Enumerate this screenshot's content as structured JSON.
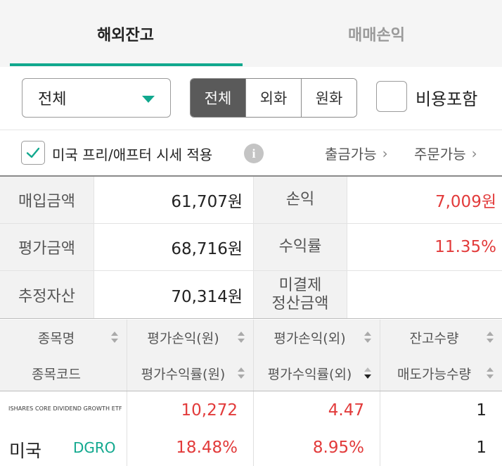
{
  "tabs": [
    {
      "label": "해외잔고",
      "active": true
    },
    {
      "label": "매매손익",
      "active": false
    }
  ],
  "filter": {
    "select_value": "전체",
    "segments": [
      {
        "label": "전체",
        "selected": true
      },
      {
        "label": "외화",
        "selected": false
      },
      {
        "label": "원화",
        "selected": false
      }
    ],
    "cost_include_label": "비용포함",
    "cost_include_checked": false
  },
  "options": {
    "premarket_label": "미국 프리/애프터 시세 적용",
    "premarket_checked": true,
    "withdraw_label": "출금가능",
    "order_label": "주문가능"
  },
  "summary": {
    "rows": [
      {
        "label": "매입금액",
        "value": "61,707원",
        "label2": "손익",
        "value2": "7,009원"
      },
      {
        "label": "평가금액",
        "value": "68,716원",
        "label2": "수익률",
        "value2": "11.35%"
      },
      {
        "label": "추정자산",
        "value": "70,314원",
        "label2": "미결제\n정산금액",
        "value2": ""
      }
    ]
  },
  "holdings": {
    "headers_top": [
      "종목명",
      "평가손익(원)",
      "평가손익(외)",
      "잔고수량"
    ],
    "headers_bottom": [
      "종목코드",
      "평가수익률(원)",
      "평가수익률(외)",
      "매도가능수량"
    ],
    "items": [
      {
        "name": "ISHARES CORE DIVIDEND GROWTH ETF",
        "country": "미국",
        "ticker": "DGRO",
        "pl_krw": "10,272",
        "pl_fx": "4.47",
        "qty": "1",
        "rate_krw": "18.48%",
        "rate_fx": "8.95%",
        "sellable_qty": "1"
      }
    ]
  },
  "colors": {
    "accent": "#11a88e",
    "positive": "#e23b3b",
    "segment_selected": "#5a5a5a"
  }
}
